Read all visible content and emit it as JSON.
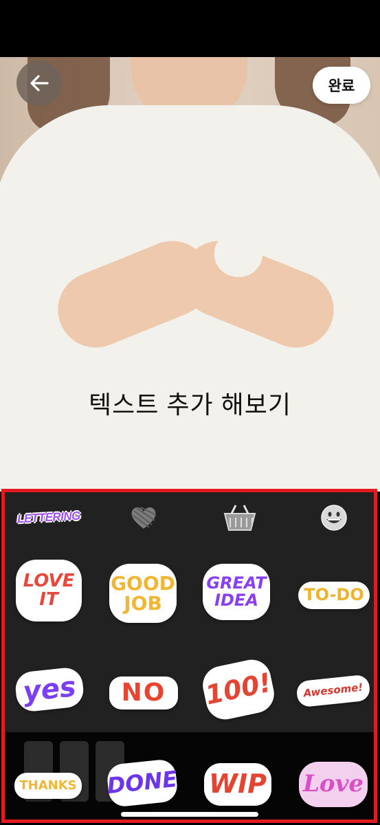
{
  "header": {
    "done_label": "완료"
  },
  "photo": {
    "caption": "텍스트 추가 해보기"
  },
  "sticker_panel": {
    "highlight_color": "#e21b23",
    "categories": [
      {
        "label": "LETTERING",
        "icon": "lettering-category-icon",
        "selected": true
      },
      {
        "icon": "scribble-heart-icon"
      },
      {
        "icon": "shopping-basket-icon"
      },
      {
        "icon": "grinning-face-icon"
      }
    ],
    "stickers": [
      {
        "text": "LOVE\nIT",
        "color": "#e8473c"
      },
      {
        "text": "GOOD\nJOB",
        "color": "#f2b632"
      },
      {
        "text": "GREAT\nIDEA",
        "color": "#8a3ff0"
      },
      {
        "text": "TO-DO",
        "color": "#f0b42a"
      },
      {
        "text": "yes",
        "color": "#7a3ff0"
      },
      {
        "text": "NO",
        "color": "#e8442f"
      },
      {
        "text": "100!",
        "color": "#e24532"
      },
      {
        "text": "Awesome!",
        "color": "#d7372e"
      },
      {
        "text": "THANKS",
        "color": "#f2b632"
      },
      {
        "text": "DONE",
        "color": "#6e35e6"
      },
      {
        "text": "WIP",
        "color": "#e24532"
      },
      {
        "text": "Love",
        "color": "#d94fc7"
      }
    ]
  }
}
